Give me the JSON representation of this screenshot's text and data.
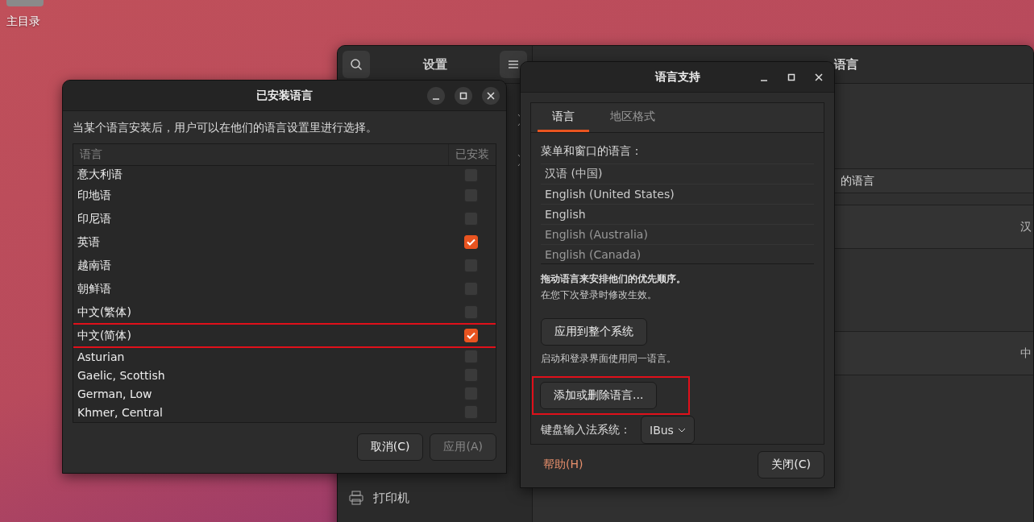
{
  "desktop": {
    "home_label": "主目录"
  },
  "settings": {
    "title": "设置",
    "page_title": "语言",
    "rows": [
      {
        "label": "的语言",
        "value": ""
      },
      {
        "label": "",
        "value": "汉"
      },
      {
        "label": "",
        "value": "中"
      }
    ],
    "sidebar_bottom": "打印机"
  },
  "installed_dialog": {
    "title": "已安装语言",
    "description": "当某个语言安装后，用户可以在他们的语言设置里进行选择。",
    "columns": [
      "语言",
      "已安装"
    ],
    "rows": [
      {
        "name": "意大利语",
        "checked": false,
        "highlighted": false
      },
      {
        "name": "印地语",
        "checked": false,
        "highlighted": false
      },
      {
        "name": "印尼语",
        "checked": false,
        "highlighted": false
      },
      {
        "name": "英语",
        "checked": true,
        "highlighted": false
      },
      {
        "name": "越南语",
        "checked": false,
        "highlighted": false
      },
      {
        "name": "朝鲜语",
        "checked": false,
        "highlighted": false
      },
      {
        "name": "中文(繁体)",
        "checked": false,
        "highlighted": false
      },
      {
        "name": "中文(简体)",
        "checked": true,
        "highlighted": true
      },
      {
        "name": "Asturian",
        "checked": false,
        "highlighted": false
      },
      {
        "name": "Gaelic, Scottish",
        "checked": false,
        "highlighted": false
      },
      {
        "name": "German, Low",
        "checked": false,
        "highlighted": false
      },
      {
        "name": "Khmer, Central",
        "checked": false,
        "highlighted": false
      }
    ],
    "buttons": [
      {
        "label": "取消(C)",
        "disabled": false
      },
      {
        "label": "应用(A)",
        "disabled": true
      }
    ]
  },
  "support_dialog": {
    "title": "语言支持",
    "tabs": [
      {
        "label": "语言",
        "selected": true
      },
      {
        "label": "地区格式",
        "selected": false
      }
    ],
    "menu_label": "菜单和窗口的语言：",
    "languages": [
      {
        "name": "汉语 (中国)",
        "dimmed": false
      },
      {
        "name": "English (United States)",
        "dimmed": false
      },
      {
        "name": "English",
        "dimmed": false
      },
      {
        "name": "English (Australia)",
        "dimmed": true
      },
      {
        "name": "English (Canada)",
        "dimmed": true
      }
    ],
    "hint_bold": "拖动语言来安排他们的优先顺序。",
    "hint": "在您下次登录时修改生效。",
    "apply_button": "应用到整个系统",
    "apply_note": "启动和登录界面使用同一语言。",
    "add_button": {
      "label": "添加或删除语言...",
      "highlighted": true
    },
    "keyboard_label": "键盘输入法系统：",
    "keyboard_value": "IBus",
    "help": "帮助(H)",
    "close": "关闭(C)"
  }
}
